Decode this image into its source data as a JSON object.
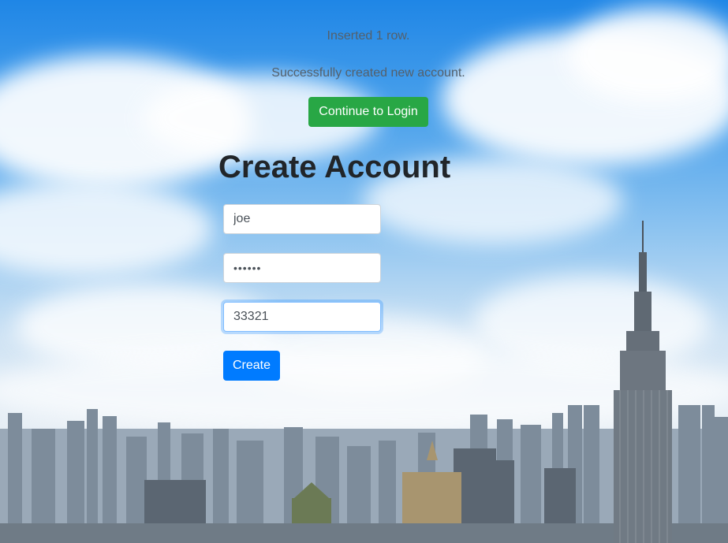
{
  "status": {
    "inserted_message": "Inserted 1 row.",
    "success_message": "Successfully created new account."
  },
  "actions": {
    "continue_login_label": "Continue to Login",
    "create_label": "Create"
  },
  "form": {
    "title": "Create Account",
    "username_value": "joe",
    "password_value": "••••••",
    "zip_value": "33321"
  },
  "colors": {
    "success_button": "#28a745",
    "primary_button": "#007bff",
    "focus_border": "#80bdff"
  }
}
